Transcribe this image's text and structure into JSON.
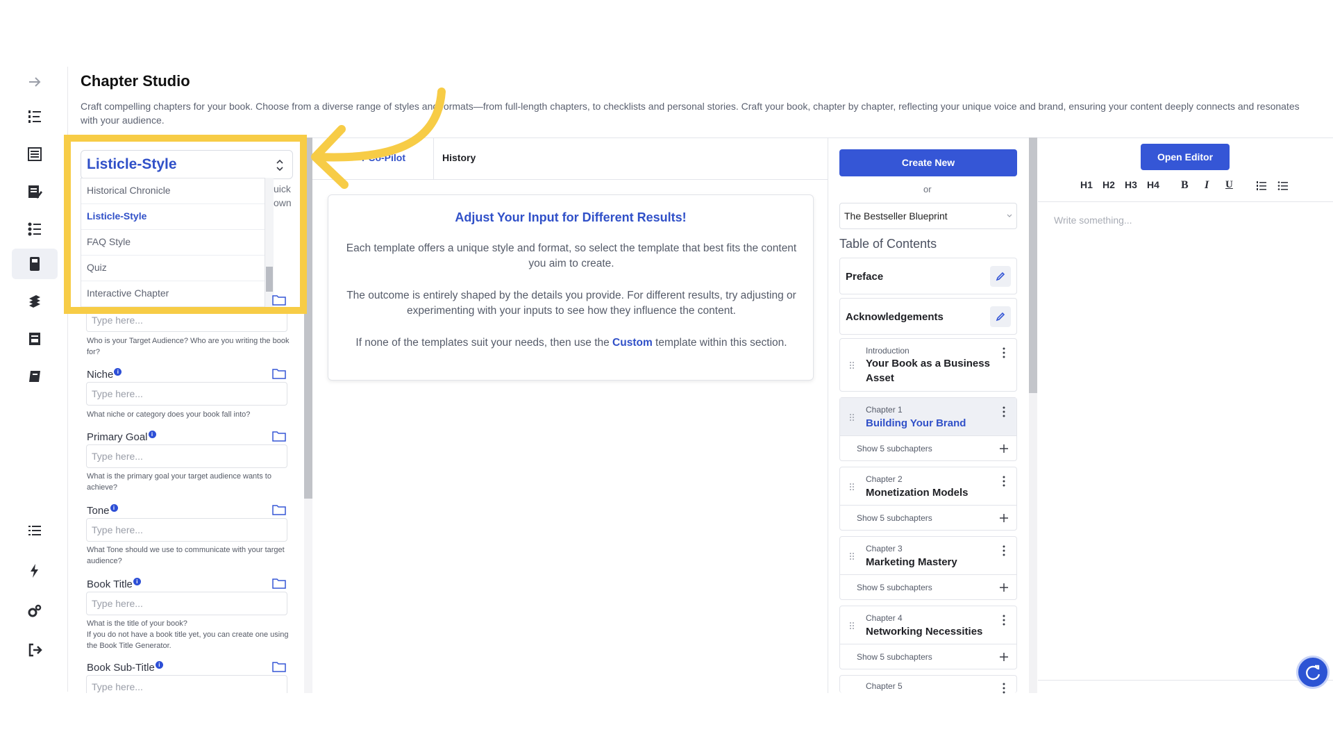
{
  "header": {
    "title": "Chapter Studio",
    "description": "Craft compelling chapters for your book. Choose from a diverse range of styles and formats—from full-length chapters, to checklists and personal stories. Craft your book, chapter by chapter, reflecting your unique voice and brand, ensuring your content deeply connects and resonates with your audience."
  },
  "rail": {
    "icons": [
      "arrow-right-icon",
      "numbered-list-icon",
      "document-list-icon",
      "edit-document-icon",
      "bullet-list-icon",
      "book-icon",
      "books-icon",
      "archive-icon",
      "notebook-icon",
      "menu-list-icon",
      "lightning-icon",
      "settings-icon",
      "logout-icon"
    ]
  },
  "template_select": {
    "value": "Listicle-Style",
    "options": [
      "Historical Chronicle",
      "Listicle-Style",
      "FAQ Style",
      "Quiz",
      "Interactive Chapter"
    ],
    "peek_1": "uick",
    "peek_2": "own"
  },
  "form": {
    "placeholder": "Type here...",
    "fields": [
      {
        "label": "",
        "help": "Who is your Target Audience? Who are you writing the book for?"
      },
      {
        "label": "Niche",
        "help": "What niche or category does your book fall into?"
      },
      {
        "label": "Primary Goal",
        "help": "What is the primary goal your target audience wants to achieve?"
      },
      {
        "label": "Tone",
        "help": "What Tone should we use to communicate with your target audience?"
      },
      {
        "label": "Book Title",
        "help": "What is the title of your book?\nIf you do not have a book title yet, you can create one using the Book Title Generator."
      },
      {
        "label": "Book Sub-Title",
        "help": ""
      }
    ]
  },
  "center": {
    "tabs": [
      "r Co-Pilot",
      "History"
    ],
    "card_title": "Adjust Your Input for Different Results!",
    "card_p1": "Each template offers a unique style and format, so select the template that best fits the content you aim to create.",
    "card_p2": "The outcome is entirely shaped by the details you provide. For different results, try adjusting or experimenting with your inputs to see how they influence the content.",
    "card_p3_pre": "If none of the templates suit your needs, then use the ",
    "card_p3_link": "Custom",
    "card_p3_post": " template within this section."
  },
  "toc": {
    "create_new": "Create New",
    "or": "or",
    "blueprint": "The Bestseller Blueprint",
    "heading": "Table of Contents",
    "preface": "Preface",
    "acknowledgements": "Acknowledgements",
    "introduction": {
      "kicker": "Introduction",
      "title": "Your Book as a Business Asset"
    },
    "subchapters_label": "Show 5 subchapters",
    "chapters": [
      {
        "kicker": "Chapter 1",
        "title": "Building Your Brand"
      },
      {
        "kicker": "Chapter 2",
        "title": "Monetization Models"
      },
      {
        "kicker": "Chapter 3",
        "title": "Marketing Mastery"
      },
      {
        "kicker": "Chapter 4",
        "title": "Networking Necessities"
      },
      {
        "kicker": "Chapter 5",
        "title": ""
      }
    ]
  },
  "editor": {
    "open_editor": "Open Editor",
    "toolbar": [
      "H1",
      "H2",
      "H3",
      "H4",
      "B",
      "I",
      "U"
    ],
    "placeholder": "Write something..."
  },
  "colors": {
    "accent": "#3556d6",
    "highlight": "#f7cc46"
  }
}
